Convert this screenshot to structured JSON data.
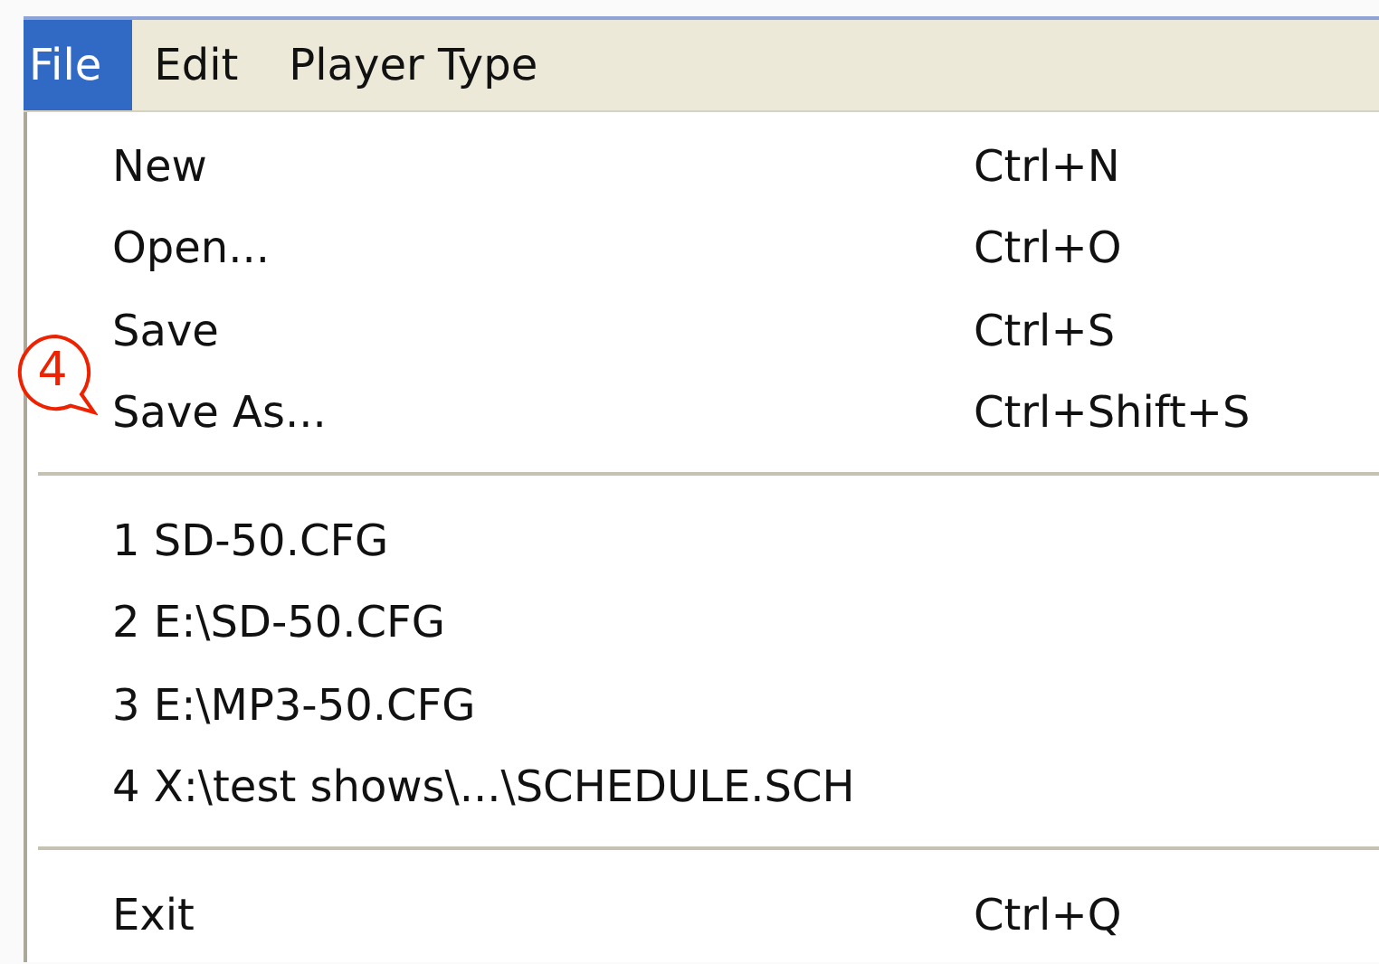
{
  "menubar": [
    {
      "label": "File",
      "selected": true
    },
    {
      "label": "Edit",
      "selected": false
    },
    {
      "label": "Player Type",
      "selected": false
    }
  ],
  "menu": {
    "items": [
      {
        "kind": "item",
        "label": "New",
        "shortcut": "Ctrl+N"
      },
      {
        "kind": "item",
        "label": "Open...",
        "shortcut": "Ctrl+O"
      },
      {
        "kind": "item",
        "label": "Save",
        "shortcut": "Ctrl+S"
      },
      {
        "kind": "item",
        "label": "Save As...",
        "shortcut": "Ctrl+Shift+S",
        "callout": "4"
      },
      {
        "kind": "separator"
      },
      {
        "kind": "item",
        "label": "1 SD-50.CFG"
      },
      {
        "kind": "item",
        "label": "2 E:\\SD-50.CFG"
      },
      {
        "kind": "item",
        "label": "3 E:\\MP3-50.CFG"
      },
      {
        "kind": "item",
        "label": "4 X:\\test shows\\...\\SCHEDULE.SCH"
      },
      {
        "kind": "separator"
      },
      {
        "kind": "item",
        "label": "Exit",
        "shortcut": "Ctrl+Q"
      }
    ]
  }
}
